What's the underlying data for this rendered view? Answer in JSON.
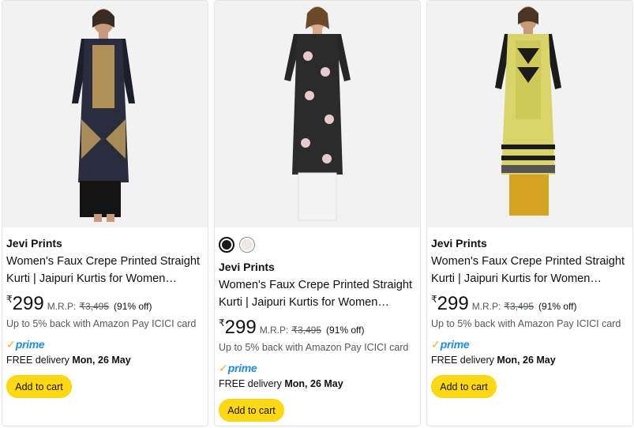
{
  "products": [
    {
      "brand": "Jevi Prints",
      "title_line1": "Women's Faux Crepe Printed Straight",
      "title_line2": "Kurti | Jaipuri Kurtis for Women…",
      "currency": "₹",
      "price": "299",
      "mrp_label": "M.R.P:",
      "mrp": "₹3,495",
      "discount": "(91% off)",
      "cashback": "Up to 5% back with Amazon Pay ICICI card",
      "prime_check": "✓",
      "prime_word": "prime",
      "delivery_prefix": "FREE delivery",
      "delivery_date": "Mon, 26 May",
      "add_to_cart": "Add to cart",
      "colors": {
        "top": "#1c1e2b",
        "skirt": "#2a2d3d",
        "pants": "#141414",
        "print": "#c7a35c"
      }
    },
    {
      "swatches": [
        {
          "name": "black",
          "color": "#1a1a1a",
          "selected": true
        },
        {
          "name": "white",
          "color": "#f0e6e6",
          "selected": false
        }
      ],
      "brand": "Jevi Prints",
      "title_line1": "Women's Faux Crepe Printed Straight",
      "title_line2": "Kurti | Jaipuri Kurtis for Women…",
      "currency": "₹",
      "price": "299",
      "mrp_label": "M.R.P:",
      "mrp": "₹3,495",
      "discount": "(91% off)",
      "cashback": "Up to 5% back with Amazon Pay ICICI card",
      "prime_check": "✓",
      "prime_word": "prime",
      "delivery_prefix": "FREE delivery",
      "delivery_date": "Mon, 26 May",
      "add_to_cart": "Add to cart",
      "colors": {
        "top": "#262626",
        "skirt": "#2b2b2b",
        "pants": "#f4f4f4",
        "print": "#e8c9cc"
      }
    },
    {
      "brand": "Jevi Prints",
      "title_line1": "Women's Faux Crepe Printed Straight",
      "title_line2": "Kurti | Jaipuri Kurtis for Women…",
      "currency": "₹",
      "price": "299",
      "mrp_label": "M.R.P:",
      "mrp": "₹3,495",
      "discount": "(91% off)",
      "cashback": "Up to 5% back with Amazon Pay ICICI card",
      "prime_check": "✓",
      "prime_word": "prime",
      "delivery_prefix": "FREE delivery",
      "delivery_date": "Mon, 26 May",
      "add_to_cart": "Add to cart",
      "colors": {
        "top": "#d9d46a",
        "skirt": "#cfc95a",
        "pants": "#d4a422",
        "print": "#1b1b1b"
      }
    }
  ],
  "theme": {
    "button_bg": "#ffd814",
    "prime_blue": "#1f8de0",
    "prime_orange": "#ffa41c",
    "muted_text": "#565959"
  }
}
